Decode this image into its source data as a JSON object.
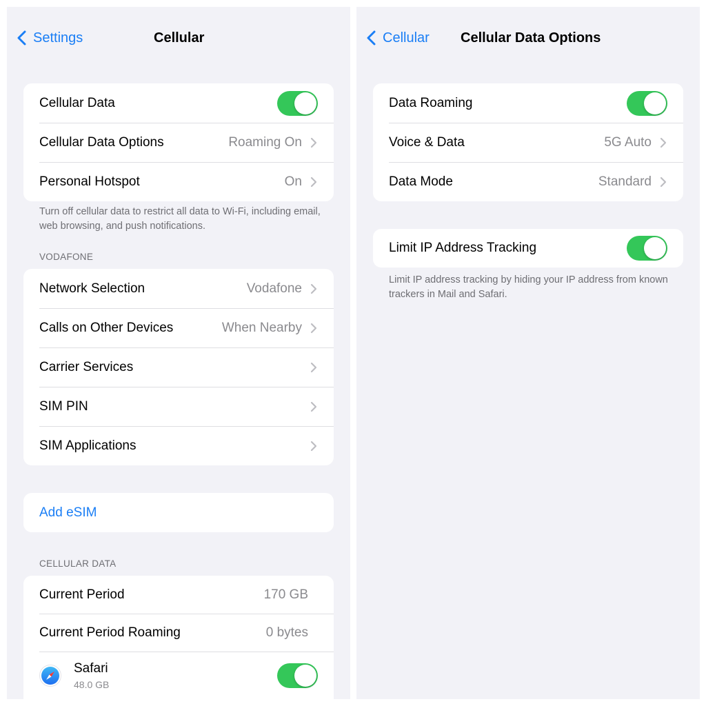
{
  "left": {
    "nav": {
      "back_label": "Settings",
      "title": "Cellular"
    },
    "group1": [
      {
        "label": "Cellular Data",
        "toggle": true
      },
      {
        "label": "Cellular Data Options",
        "value": "Roaming On"
      },
      {
        "label": "Personal Hotspot",
        "value": "On"
      }
    ],
    "footer1": "Turn off cellular data to restrict all data to Wi-Fi, including email, web browsing, and push notifications.",
    "carrier_header": "VODAFONE",
    "carrier_group": [
      {
        "label": "Network Selection",
        "value": "Vodafone"
      },
      {
        "label": "Calls on Other Devices",
        "value": "When Nearby"
      },
      {
        "label": "Carrier Services",
        "value": ""
      },
      {
        "label": "SIM PIN",
        "value": ""
      },
      {
        "label": "SIM Applications",
        "value": ""
      }
    ],
    "add_esim": "Add eSIM",
    "data_header": "CELLULAR DATA",
    "data_group": [
      {
        "label": "Current Period",
        "value": "170 GB"
      },
      {
        "label": "Current Period Roaming",
        "value": "0 bytes"
      }
    ],
    "apps": [
      {
        "name": "Safari",
        "size": "48.0 GB",
        "icon": "safari-compass-icon",
        "toggle": true
      }
    ]
  },
  "right": {
    "nav": {
      "back_label": "Cellular",
      "title": "Cellular Data Options"
    },
    "group1": [
      {
        "label": "Data Roaming",
        "toggle": true
      },
      {
        "label": "Voice & Data",
        "value": "5G Auto"
      },
      {
        "label": "Data Mode",
        "value": "Standard"
      }
    ],
    "group2": [
      {
        "label": "Limit IP Address Tracking",
        "toggle": true
      }
    ],
    "footer2": "Limit IP address tracking by hiding your IP address from known trackers in Mail and Safari."
  },
  "colors": {
    "accent": "#1a7ef5",
    "toggle_on": "#34c759",
    "background": "#f2f2f7"
  }
}
